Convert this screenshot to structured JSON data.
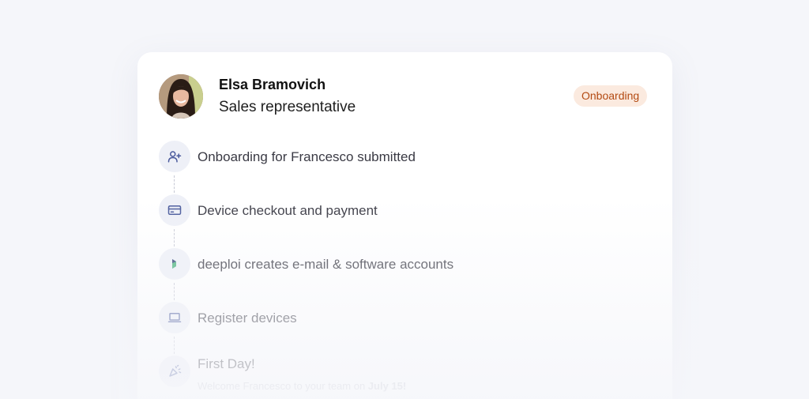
{
  "profile": {
    "name": "Elsa Bramovich",
    "role": "Sales representative",
    "status_badge": "Onboarding"
  },
  "steps": [
    {
      "label": "Onboarding for Francesco submitted",
      "icon": "user-plus-icon"
    },
    {
      "label": "Device checkout and payment",
      "icon": "credit-card-icon"
    },
    {
      "label": "deeploi creates e-mail & software accounts",
      "icon": "deeploi-logo-icon"
    },
    {
      "label": "Register devices",
      "icon": "laptop-icon"
    },
    {
      "label": "First Day!",
      "icon": "party-popper-icon"
    }
  ],
  "first_day_note": {
    "prefix": "Welcome Francesco to your team on ",
    "date": "July 15!"
  },
  "colors": {
    "badge_bg": "#fbeadf",
    "badge_text": "#b34a12",
    "icon_accent": "#4a5a9c"
  }
}
